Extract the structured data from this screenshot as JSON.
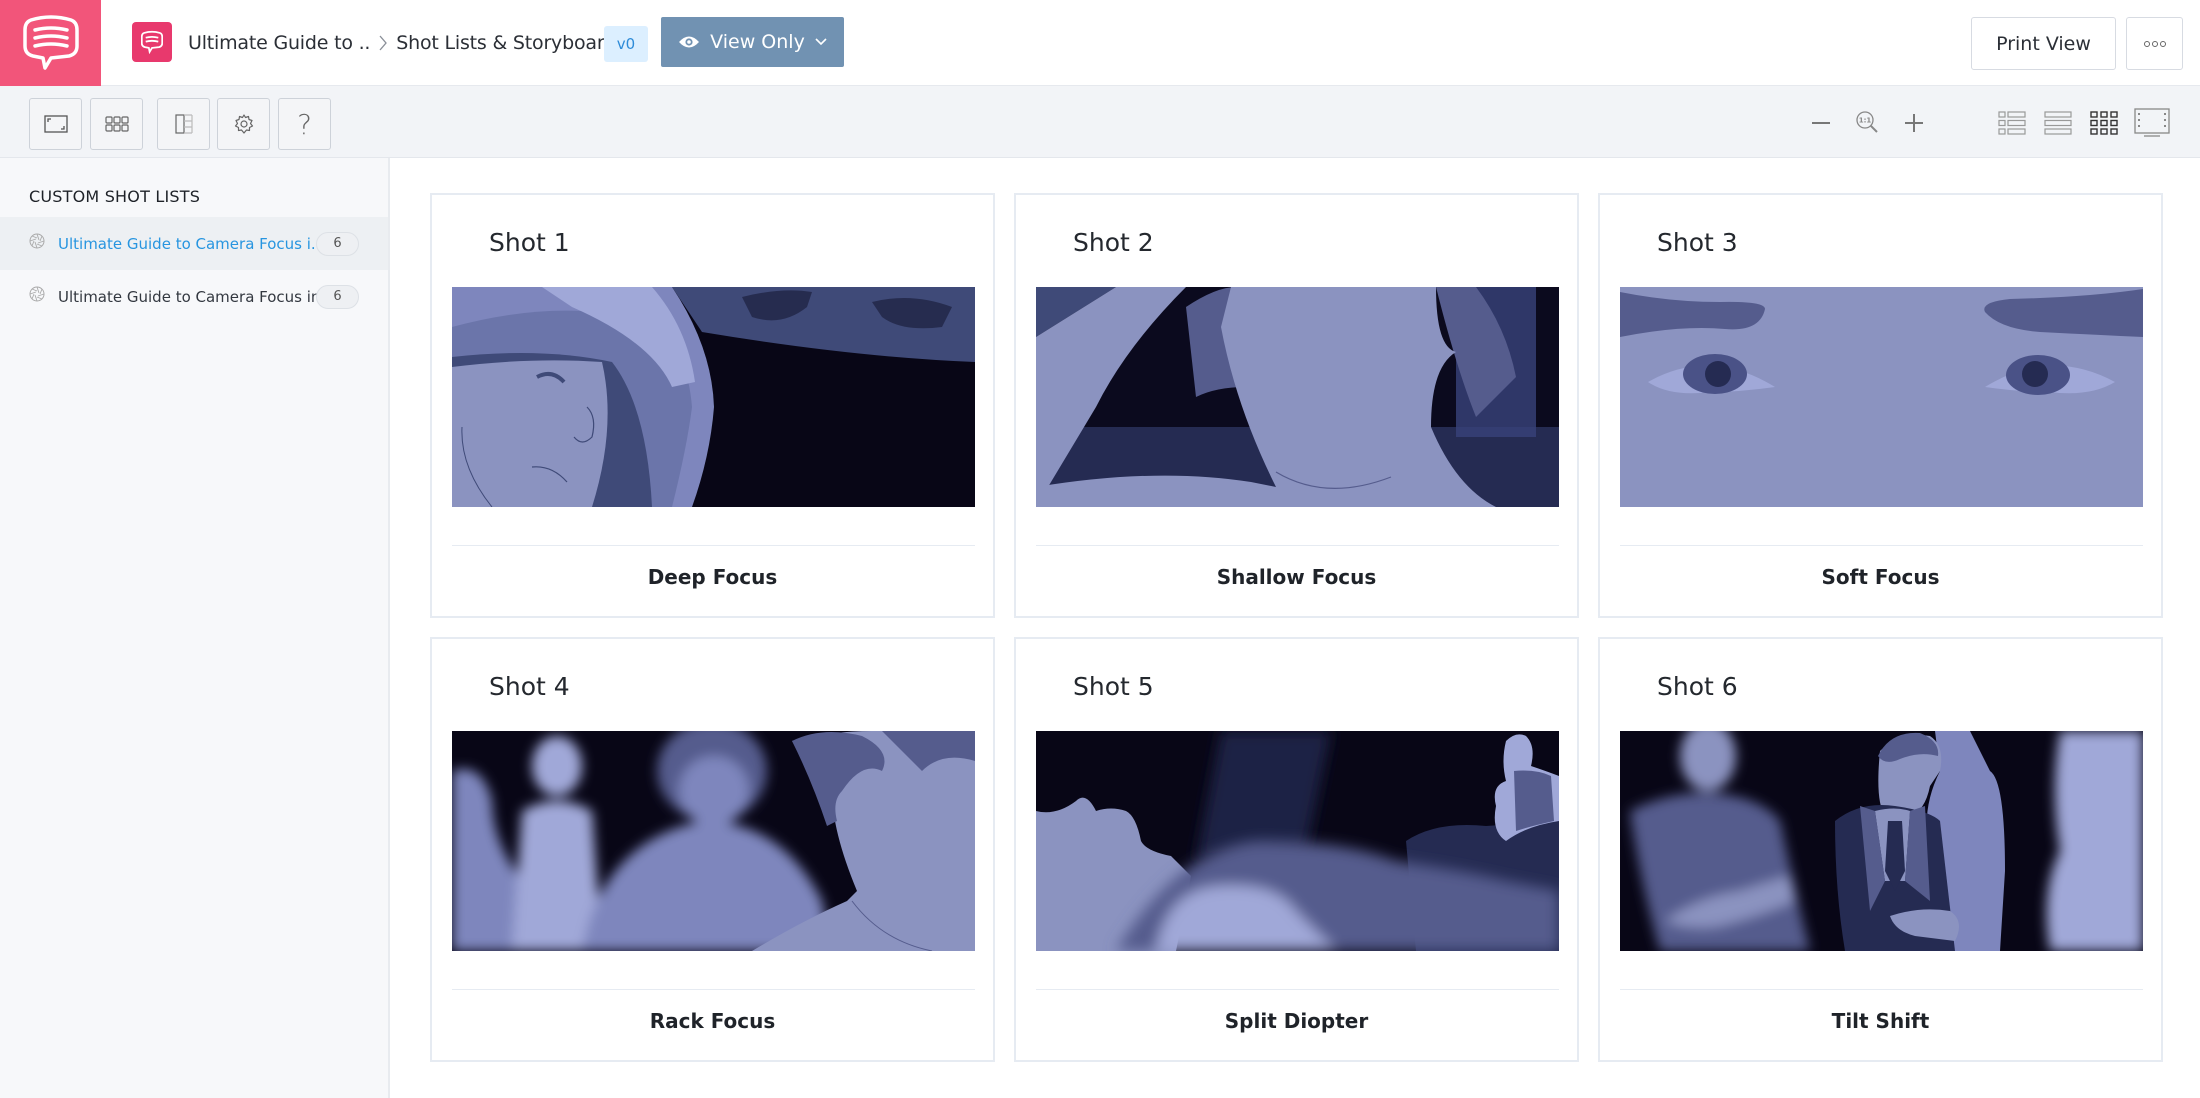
{
  "header": {
    "breadcrumb": [
      "Ultimate Guide to ..",
      "Shot Lists & Storyboards"
    ],
    "version": "v0",
    "view_mode": "View Only",
    "print_label": "Print View",
    "more_icon": "ellipsis-icon",
    "brand_color": "#f2557a"
  },
  "toolbar": {
    "left_buttons": [
      "fullscreen-icon",
      "grid-icon",
      "column-layout-icon",
      "settings-icon",
      "help-icon"
    ],
    "help_glyph": "?",
    "zoom_buttons": [
      "zoom-out-icon",
      "zoom-reset-icon",
      "zoom-in-icon"
    ],
    "zoom_reset_label": "1:1",
    "view_buttons": [
      "list-with-thumbs-icon",
      "list-icon",
      "grid-view-icon",
      "filmstrip-icon"
    ],
    "active_view": "grid-view"
  },
  "sidebar": {
    "title": "CUSTOM SHOT LISTS",
    "items": [
      {
        "label": "Ultimate Guide to Camera Focus i...",
        "count": "6",
        "active": true
      },
      {
        "label": "Ultimate Guide to Camera Focus in...",
        "count": "6",
        "active": false
      }
    ],
    "active_color": "#2795e0"
  },
  "shots": [
    {
      "title": "Shot 1",
      "name": "Deep Focus",
      "image": "astronaut in helmet with Earth behind"
    },
    {
      "title": "Shot 2",
      "name": "Shallow Focus",
      "image": "close-up of person's chin and hair"
    },
    {
      "title": "Shot 3",
      "name": "Soft Focus",
      "image": "extreme close-up of eyes"
    },
    {
      "title": "Shot 4",
      "name": "Rack Focus",
      "image": "blurred figures in crowd"
    },
    {
      "title": "Shot 5",
      "name": "Split Diopter",
      "image": "person lying down with figure in background"
    },
    {
      "title": "Shot 6",
      "name": "Tilt Shift",
      "image": "man in suit among blurred crowd"
    }
  ]
}
